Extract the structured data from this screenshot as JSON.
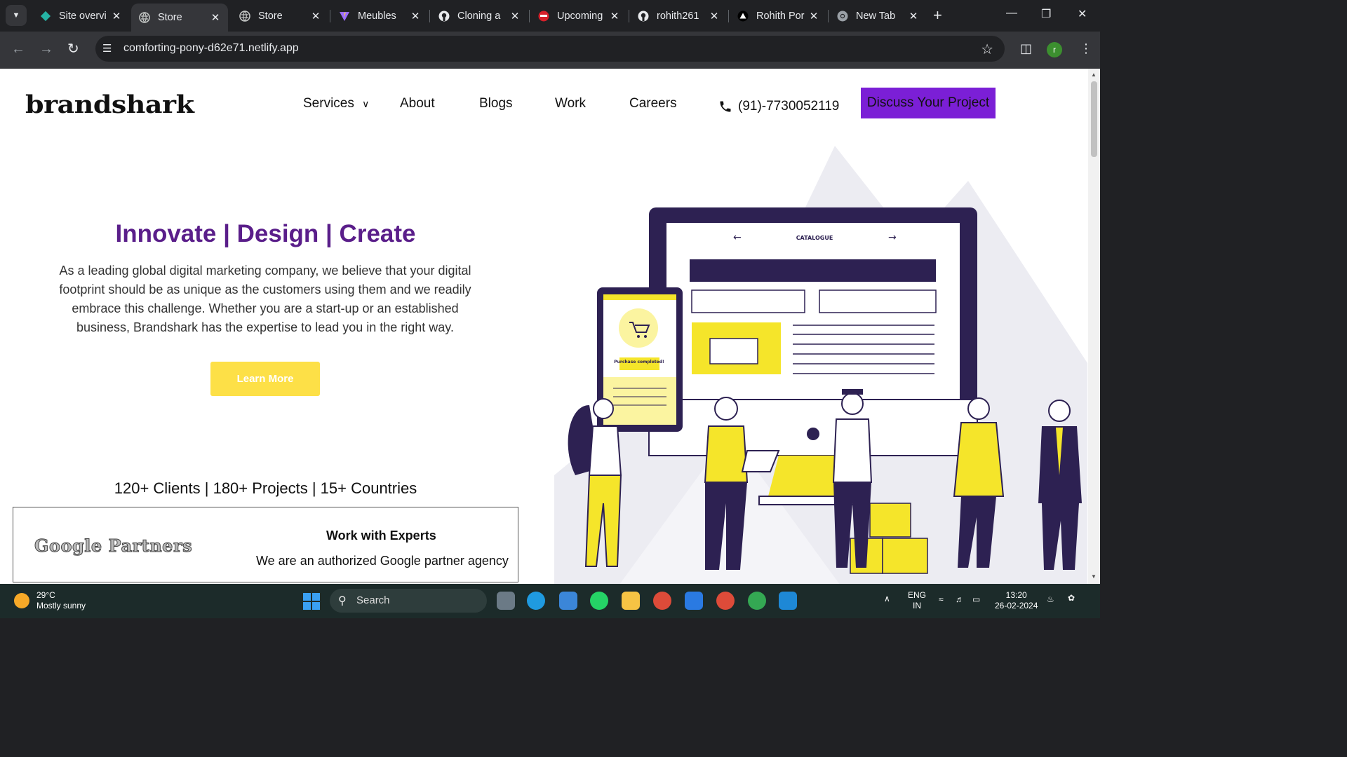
{
  "browser": {
    "tabs": [
      {
        "title": "Site overvi",
        "icon": "netlify-diamond-icon",
        "active": false
      },
      {
        "title": "Store",
        "icon": "globe-icon",
        "active": true
      },
      {
        "title": "Store",
        "icon": "globe-icon",
        "active": false
      },
      {
        "title": "Meubles",
        "icon": "vite-icon",
        "active": false
      },
      {
        "title": "Cloning a",
        "icon": "github-icon",
        "active": false
      },
      {
        "title": "Upcoming",
        "icon": "red-app-icon",
        "active": false
      },
      {
        "title": "rohith261",
        "icon": "github-icon",
        "active": false
      },
      {
        "title": "Rohith Por",
        "icon": "vercel-triangle-icon",
        "active": false
      },
      {
        "title": "New Tab",
        "icon": "chrome-icon",
        "active": false
      }
    ],
    "url": "comforting-pony-d62e71.netlify.app",
    "profile_initial": "r"
  },
  "site": {
    "logo": "brandshark",
    "nav": {
      "services": "Services",
      "about": "About",
      "blogs": "Blogs",
      "work": "Work",
      "careers": "Careers"
    },
    "phone": "(91)-7730052119",
    "cta": "Discuss Your Project",
    "hero": {
      "title": "Innovate | Design | Create",
      "text": "As a leading global digital marketing company, we believe that your digital footprint should be as unique as the customers using them and we readily embrace this challenge. Whether you are a start-up or an established business, Brandshark has the expertise to lead you in the right way.",
      "button": "Learn More"
    },
    "stats": "120+ Clients | 180+ Projects | 15+ Countries",
    "partner": {
      "logo_text": "Google Partners",
      "title": "Work with Experts",
      "text": "We are an authorized Google partner agency"
    },
    "illustration": {
      "screen_title": "CATALOGUE",
      "badge": "Purchase completed!"
    },
    "colors": {
      "purple_title": "#5a1e8a",
      "cta_bg": "#7b1fd6",
      "yellow": "#fde047",
      "illus_navy": "#2d2152",
      "illus_yellow": "#f5e52a"
    }
  },
  "taskbar": {
    "weather_temp": "29°C",
    "weather_desc": "Mostly sunny",
    "search": "Search",
    "lang_1": "ENG",
    "lang_2": "IN",
    "time": "13:20",
    "date": "26-02-2024"
  }
}
